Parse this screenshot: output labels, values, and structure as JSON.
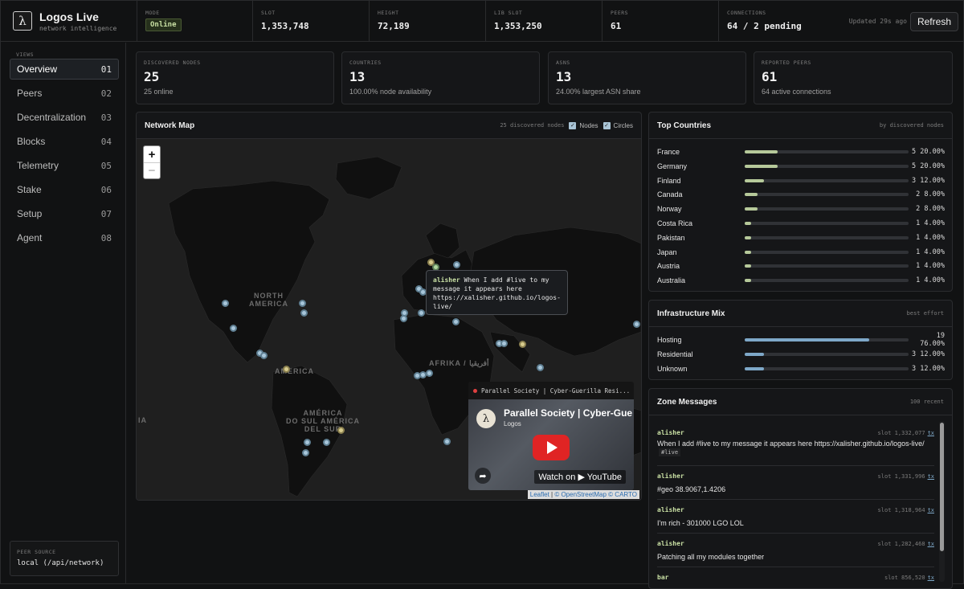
{
  "app": {
    "title": "Logos Live",
    "subtitle": "network intelligence",
    "logo_glyph": "λ"
  },
  "header": {
    "stats": [
      {
        "label": "MODE",
        "value": "Online"
      },
      {
        "label": "SLOT",
        "value": "1,353,748"
      },
      {
        "label": "HEIGHT",
        "value": "72,189"
      },
      {
        "label": "LIB SLOT",
        "value": "1,353,250"
      },
      {
        "label": "PEERS",
        "value": "61"
      },
      {
        "label": "CONNECTIONS",
        "value": "64 / 2 pending"
      }
    ],
    "updated": "Updated 29s ago",
    "refresh_label": "Refresh"
  },
  "sidebar": {
    "section_label": "VIEWS",
    "items": [
      {
        "label": "Overview",
        "num": "01",
        "active": true
      },
      {
        "label": "Peers",
        "num": "02"
      },
      {
        "label": "Decentralization",
        "num": "03"
      },
      {
        "label": "Blocks",
        "num": "04"
      },
      {
        "label": "Telemetry",
        "num": "05"
      },
      {
        "label": "Stake",
        "num": "06"
      },
      {
        "label": "Setup",
        "num": "07"
      },
      {
        "label": "Agent",
        "num": "08"
      }
    ],
    "peer_source": {
      "label": "PEER SOURCE",
      "value": "local (/api/network)"
    }
  },
  "kpis": [
    {
      "label": "DISCOVERED NODES",
      "value": "25",
      "sub": "25 online"
    },
    {
      "label": "COUNTRIES",
      "value": "13",
      "sub": "100.00% node availability"
    },
    {
      "label": "ASNS",
      "value": "13",
      "sub": "24.00% largest ASN share"
    },
    {
      "label": "REPORTED PEERS",
      "value": "61",
      "sub": "64 active connections"
    }
  ],
  "map": {
    "title": "Network Map",
    "hint": "25 discovered nodes",
    "toggle_nodes": "Nodes",
    "toggle_circles": "Circles",
    "zoom_in": "+",
    "zoom_out": "−",
    "labels": {
      "north_america_1": "NORTH",
      "north_america_2": "AMERICA",
      "south_america_1": "AMÉRICA",
      "south_america_2": "DO SUL",
      "south_america_3": "AMÉRICA",
      "south_america_4": "DEL SUR",
      "africa": "AFRIKA / أفريقيا",
      "america_mid": "AMERICA",
      "edge_ia": "IA"
    },
    "tooltip": {
      "user": "alisher",
      "text": "When I add #live to my message it appears here https://xalisher.github.io/logos-live/"
    },
    "video": {
      "bar_title": "Parallel Society | Cyber-Guerilla Resi...",
      "title": "Parallel Society | Cyber-Gue",
      "channel": "Logos",
      "watch": "Watch on ▶ YouTube"
    },
    "attribution": {
      "leaflet": "Leaflet",
      "osm": "© OpenStreetMap",
      "carto": "© CARTO"
    }
  },
  "top_countries": {
    "title": "Top Countries",
    "hint": "by discovered nodes",
    "rows": [
      {
        "name": "France",
        "count": "5",
        "pct": "20.00%",
        "frac": 0.2
      },
      {
        "name": "Germany",
        "count": "5",
        "pct": "20.00%",
        "frac": 0.2
      },
      {
        "name": "Finland",
        "count": "3",
        "pct": "12.00%",
        "frac": 0.12
      },
      {
        "name": "Canada",
        "count": "2",
        "pct": "8.00%",
        "frac": 0.08
      },
      {
        "name": "Norway",
        "count": "2",
        "pct": "8.00%",
        "frac": 0.08
      },
      {
        "name": "Costa Rica",
        "count": "1",
        "pct": "4.00%",
        "frac": 0.04
      },
      {
        "name": "Pakistan",
        "count": "1",
        "pct": "4.00%",
        "frac": 0.04
      },
      {
        "name": "Japan",
        "count": "1",
        "pct": "4.00%",
        "frac": 0.04
      },
      {
        "name": "Austria",
        "count": "1",
        "pct": "4.00%",
        "frac": 0.04
      },
      {
        "name": "Australia",
        "count": "1",
        "pct": "4.00%",
        "frac": 0.04
      }
    ]
  },
  "infrastructure": {
    "title": "Infrastructure Mix",
    "hint": "best effort",
    "rows": [
      {
        "name": "Hosting",
        "count": "19",
        "pct": "76.00%",
        "frac": 0.76
      },
      {
        "name": "Residential",
        "count": "3",
        "pct": "12.00%",
        "frac": 0.12
      },
      {
        "name": "Unknown",
        "count": "3",
        "pct": "12.00%",
        "frac": 0.12
      }
    ]
  },
  "zone": {
    "title": "Zone Messages",
    "hint": "100 recent",
    "messages": [
      {
        "user": "alisher",
        "slot": "slot 1,332,077",
        "tx": "tx",
        "text": "When I add #live to my message it appears here https://xalisher.github.io/logos-live/",
        "tag": "#live"
      },
      {
        "user": "alisher",
        "slot": "slot 1,331,996",
        "tx": "tx",
        "text": "#geo 38.9067,1.4206"
      },
      {
        "user": "alisher",
        "slot": "slot 1,318,964",
        "tx": "tx",
        "text": "I'm rich - 301000 LGO LOL"
      },
      {
        "user": "alisher",
        "slot": "slot 1,282,468",
        "tx": "tx",
        "text": "Patching all my modules together"
      },
      {
        "user": "bar",
        "slot": "slot 856,520",
        "tx": "tx",
        "text": ""
      }
    ]
  },
  "colors": {
    "accent_green": "#c9e0a4",
    "bar_green": "#b6c99a",
    "bar_blue": "#7ea8c8",
    "node_blue": "#a8c6da",
    "node_yellow": "#d7cc8e"
  }
}
